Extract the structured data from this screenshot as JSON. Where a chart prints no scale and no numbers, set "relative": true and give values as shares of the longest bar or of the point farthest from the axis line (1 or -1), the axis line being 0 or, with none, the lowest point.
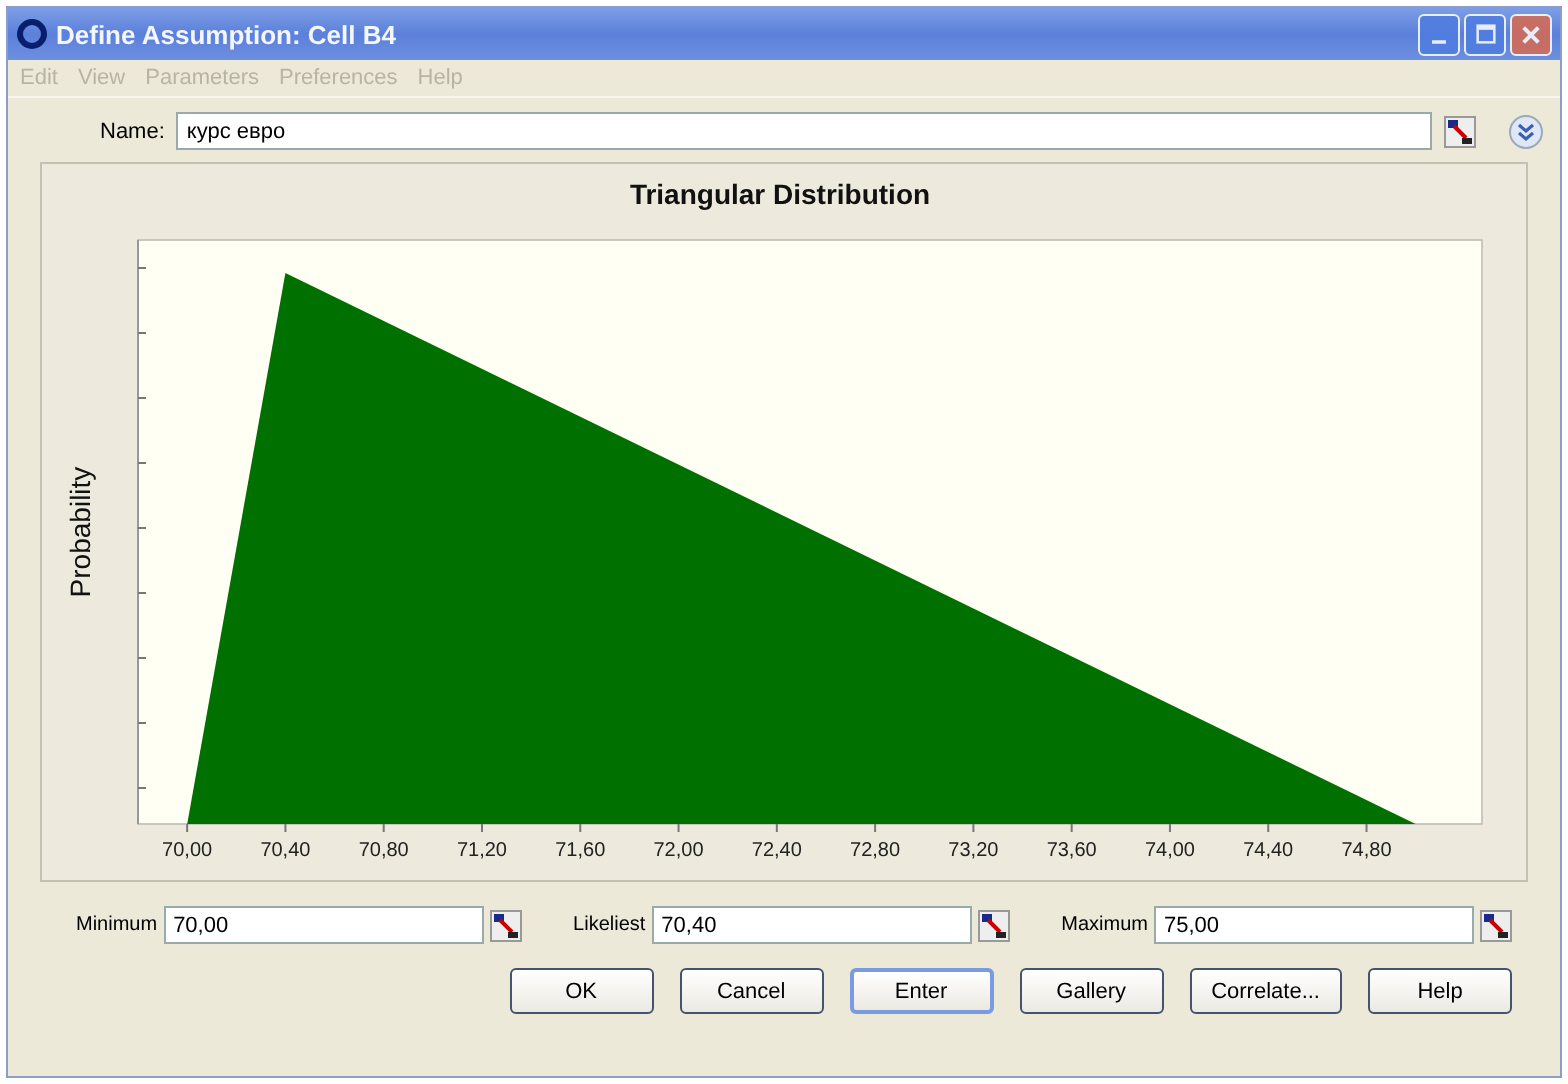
{
  "window": {
    "title": "Define Assumption: Cell B4"
  },
  "menu": [
    {
      "label": "Edit",
      "disabled": true
    },
    {
      "label": "View",
      "disabled": true
    },
    {
      "label": "Parameters",
      "disabled": true
    },
    {
      "label": "Preferences",
      "disabled": true
    },
    {
      "label": "Help",
      "disabled": true
    }
  ],
  "name_field": {
    "label": "Name:",
    "value": "курс евро"
  },
  "chart": {
    "chart_data": {
      "type": "area",
      "title": "Triangular Distribution",
      "ylabel": "Probability",
      "x": [
        70,
        70.4,
        75
      ],
      "relative": true,
      "series": [
        {
          "color": "#007000",
          "values": [
            0,
            1,
            0
          ]
        }
      ],
      "xlim": [
        69.8,
        75.27
      ],
      "ylim": [
        0,
        1.06
      ],
      "xticks": [
        {
          "value": 70,
          "label": "70,00"
        },
        {
          "value": 70.4,
          "label": "70,40"
        },
        {
          "value": 70.8,
          "label": "70,80"
        },
        {
          "value": 71.2,
          "label": "71,20"
        },
        {
          "value": 71.6,
          "label": "71,60"
        },
        {
          "value": 72,
          "label": "72,00"
        },
        {
          "value": 72.4,
          "label": "72,40"
        },
        {
          "value": 72.8,
          "label": "72,80"
        },
        {
          "value": 73.2,
          "label": "73,20"
        },
        {
          "value": 73.6,
          "label": "73,60"
        },
        {
          "value": 74,
          "label": "74,00"
        },
        {
          "value": 74.4,
          "label": "74,40"
        },
        {
          "value": 74.8,
          "label": "74,80"
        }
      ]
    }
  },
  "parameters": [
    {
      "label": "Minimum",
      "value": "70,00"
    },
    {
      "label": "Likeliest",
      "value": "70,40"
    },
    {
      "label": "Maximum",
      "value": "75,00"
    }
  ],
  "buttons": [
    {
      "label": "OK",
      "selected": false
    },
    {
      "label": "Cancel",
      "selected": false
    },
    {
      "label": "Enter",
      "selected": true
    },
    {
      "label": "Gallery",
      "selected": false
    },
    {
      "label": "Correlate...",
      "selected": false
    },
    {
      "label": "Help",
      "selected": false
    }
  ]
}
